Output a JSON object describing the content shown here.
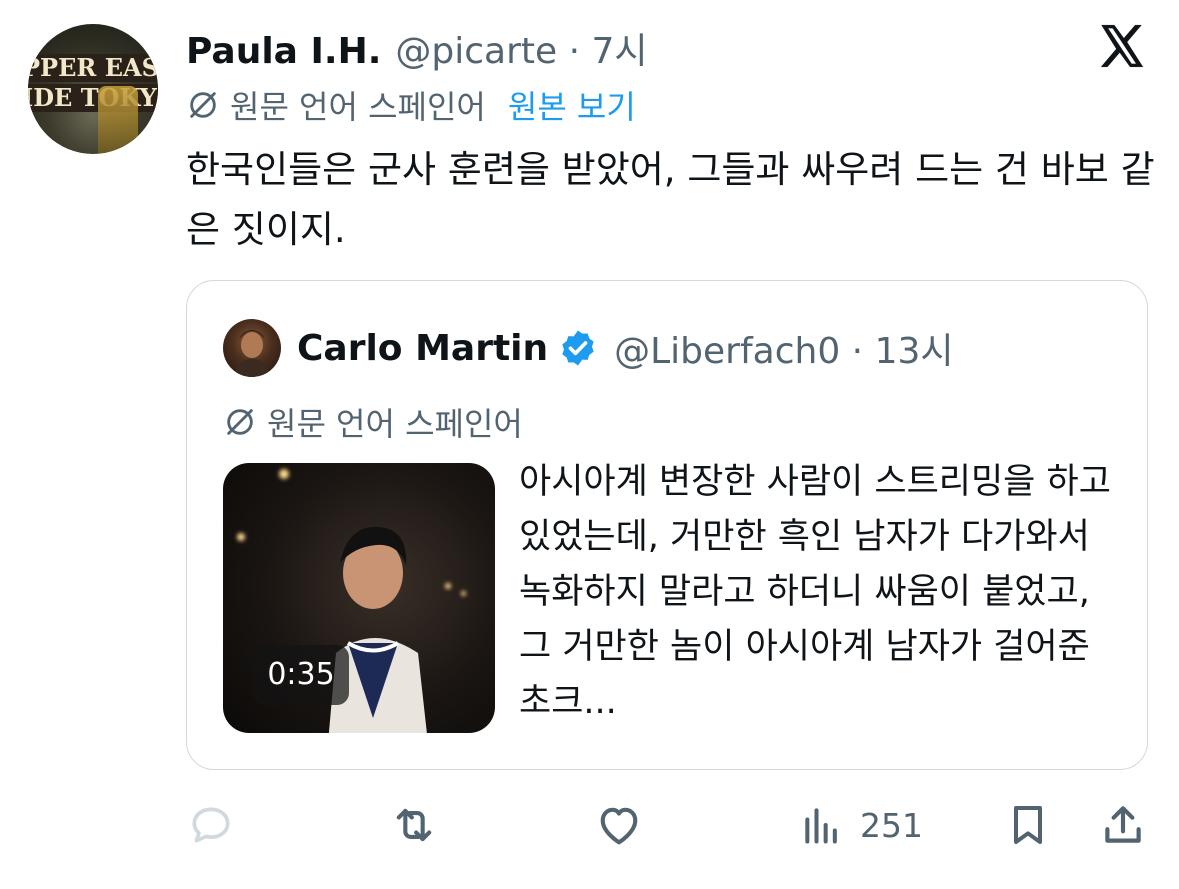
{
  "tweet": {
    "author_name": "Paula I.H.",
    "author_meta": "@picarte · 7시",
    "avatar_text_line1": "PPER EAS",
    "avatar_text_line2": "IDE TOKYO",
    "language_label": "원문 언어 스페인어",
    "view_original": "원본 보기",
    "text": "한국인들은 군사 훈련을 받았어, 그들과 싸우려 드는 건 바보 같은 짓이지."
  },
  "quote": {
    "author_name": "Carlo Martin",
    "author_meta": "@Liberfach0 · 13시",
    "language_label": "원문 언어 스페인어",
    "video_duration": "0:35",
    "text": "아시아계 변장한 사람이 스트리밍을 하고 있었는데, 거만한 흑인 남자가 다가와서 녹화하지 말라고 하더니 싸움이 붙었고, 그 거만한 놈이 아시아계 남자가 걸어준 초크..."
  },
  "actions": {
    "views_count": "251",
    "icons": [
      "reply-icon",
      "retweet-icon",
      "like-icon",
      "views-icon",
      "bookmark-icon",
      "share-icon"
    ]
  },
  "colors": {
    "text_primary": "#0f1419",
    "text_secondary": "#536471",
    "accent": "#1d9bf0",
    "border": "#cfd9de",
    "reply_icon_disabled": "#cfd9de"
  }
}
